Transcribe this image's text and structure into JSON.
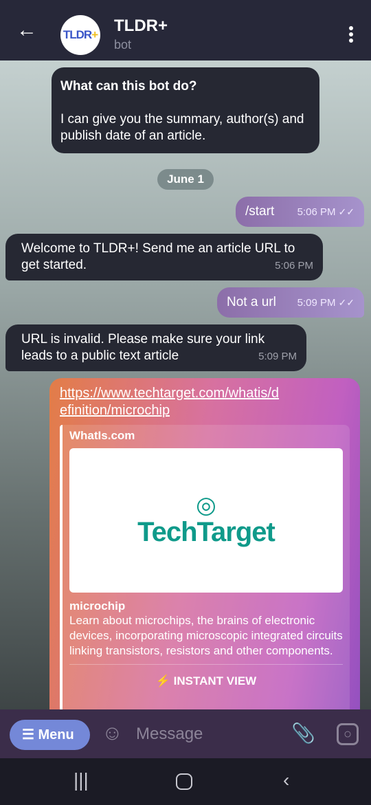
{
  "header": {
    "title": "TLDR+",
    "subtitle": "bot",
    "avatar_text": "TLDR",
    "avatar_plus": "+"
  },
  "intro": {
    "title": "What can this bot do?",
    "text": "I can give you the summary, author(s) and publish date of an article."
  },
  "date": "June 1",
  "messages": [
    {
      "dir": "out",
      "text": "/start",
      "time": "5:06 PM"
    },
    {
      "dir": "in",
      "text": "Welcome to TLDR+! Send me an article URL to get started.",
      "time": "5:06 PM"
    },
    {
      "dir": "out",
      "text": "Not a url",
      "time": "5:09 PM"
    },
    {
      "dir": "in",
      "text": "URL is invalid. Please make sure your link leads to a public text article",
      "time": "5:09 PM"
    }
  ],
  "link": {
    "url": "https://www.techtarget.com/whatis/definition/microchip",
    "site": "WhatIs.com",
    "logo": "TechTarget",
    "title": "microchip",
    "description": "Learn about microchips, the brains of electronic devices, incorporating microscopic integrated circuits linking transistors, resistors and other components.",
    "instant_view": "INSTANT VIEW"
  },
  "input": {
    "menu_label": "Menu",
    "placeholder": "Message"
  }
}
